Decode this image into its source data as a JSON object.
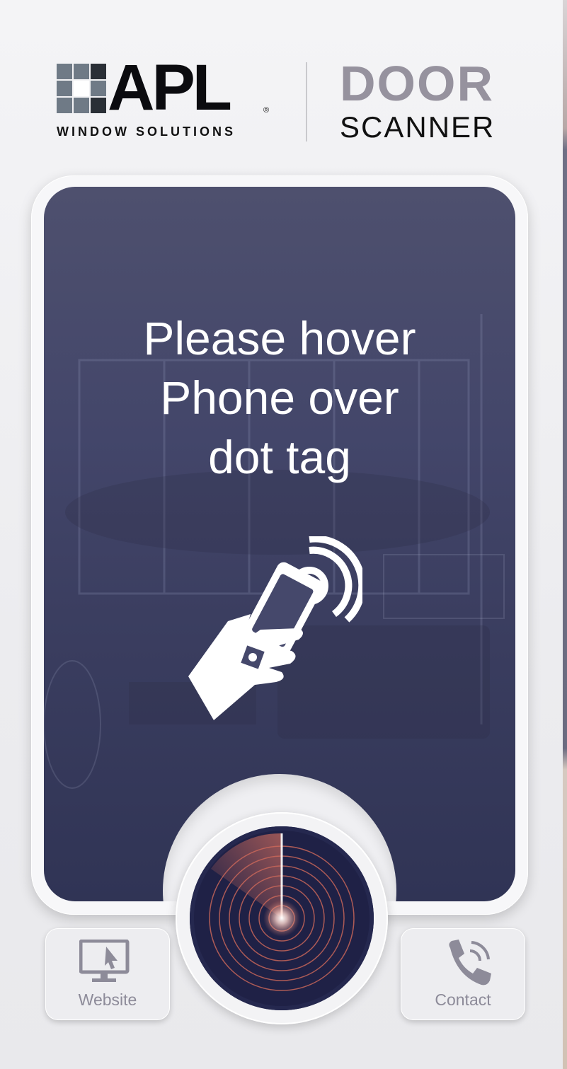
{
  "brand": {
    "name": "APL",
    "registered_mark": "®",
    "tagline": "WINDOW SOLUTIONS"
  },
  "app_title": {
    "line1": "DOOR",
    "line2": "SCANNER"
  },
  "instruction": {
    "line1": "Please hover",
    "line2": "Phone over",
    "line3": "dot tag"
  },
  "icons": {
    "hand_phone": "nfc-hand-phone-icon",
    "scan": "radar-scan-icon",
    "website": "monitor-cursor-icon",
    "contact": "phone-call-icon"
  },
  "nav": {
    "website_label": "Website",
    "contact_label": "Contact"
  },
  "colors": {
    "panel": "#43466a",
    "scan_bg": "#1f2146",
    "radar": "#e0735f",
    "title_gray": "#96929e",
    "label_gray": "#8d8b99"
  }
}
